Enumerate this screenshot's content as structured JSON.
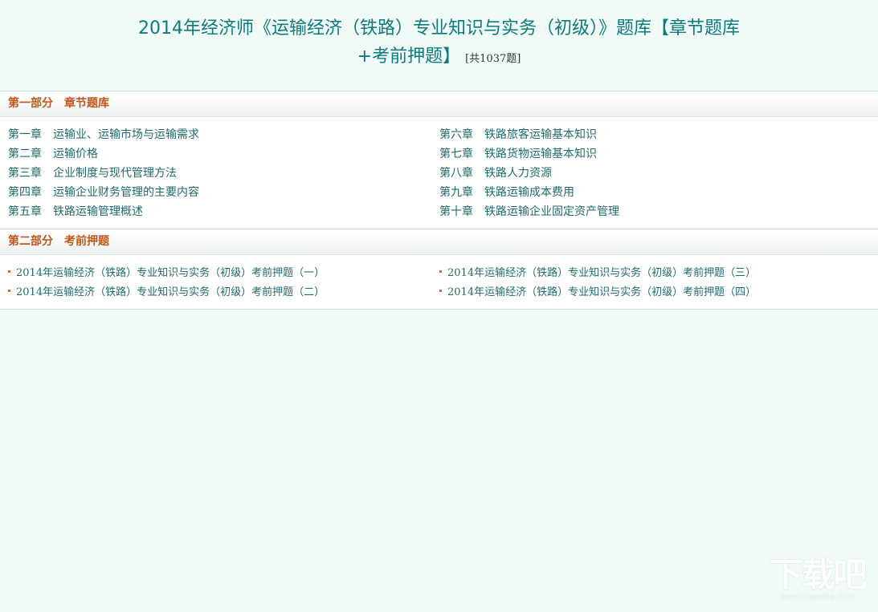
{
  "header": {
    "title_line1": "2014年经济师《运输经济（铁路）专业知识与实务（初级）》题库【章节题库",
    "title_line2": "+考前押题】",
    "count": "[共1037题]"
  },
  "part1": {
    "label": "第一部分",
    "title": "章节题库",
    "chapters_left": [
      {
        "num": "第一章",
        "name": "运输业、运输市场与运输需求"
      },
      {
        "num": "第二章",
        "name": "运输价格"
      },
      {
        "num": "第三章",
        "name": "企业制度与现代管理方法"
      },
      {
        "num": "第四章",
        "name": "运输企业财务管理的主要内容"
      },
      {
        "num": "第五章",
        "name": "铁路运输管理概述"
      }
    ],
    "chapters_right": [
      {
        "num": "第六章",
        "name": "铁路旅客运输基本知识"
      },
      {
        "num": "第七章",
        "name": "铁路货物运输基本知识"
      },
      {
        "num": "第八章",
        "name": "铁路人力资源"
      },
      {
        "num": "第九章",
        "name": "铁路运输成本费用"
      },
      {
        "num": "第十章",
        "name": "铁路运输企业固定资产管理"
      }
    ]
  },
  "part2": {
    "label": "第二部分",
    "title": "考前押题",
    "tests_left": [
      "2014年运输经济（铁路）专业知识与实务（初级）考前押题（一）",
      "2014年运输经济（铁路）专业知识与实务（初级）考前押题（二）"
    ],
    "tests_right": [
      "2014年运输经济（铁路）专业知识与实务（初级）考前押题（三）",
      "2014年运输经济（铁路）专业知识与实务（初级）考前押题（四）"
    ]
  },
  "watermark": {
    "logo": "下载吧",
    "url": "www.xiazaiba.com"
  }
}
